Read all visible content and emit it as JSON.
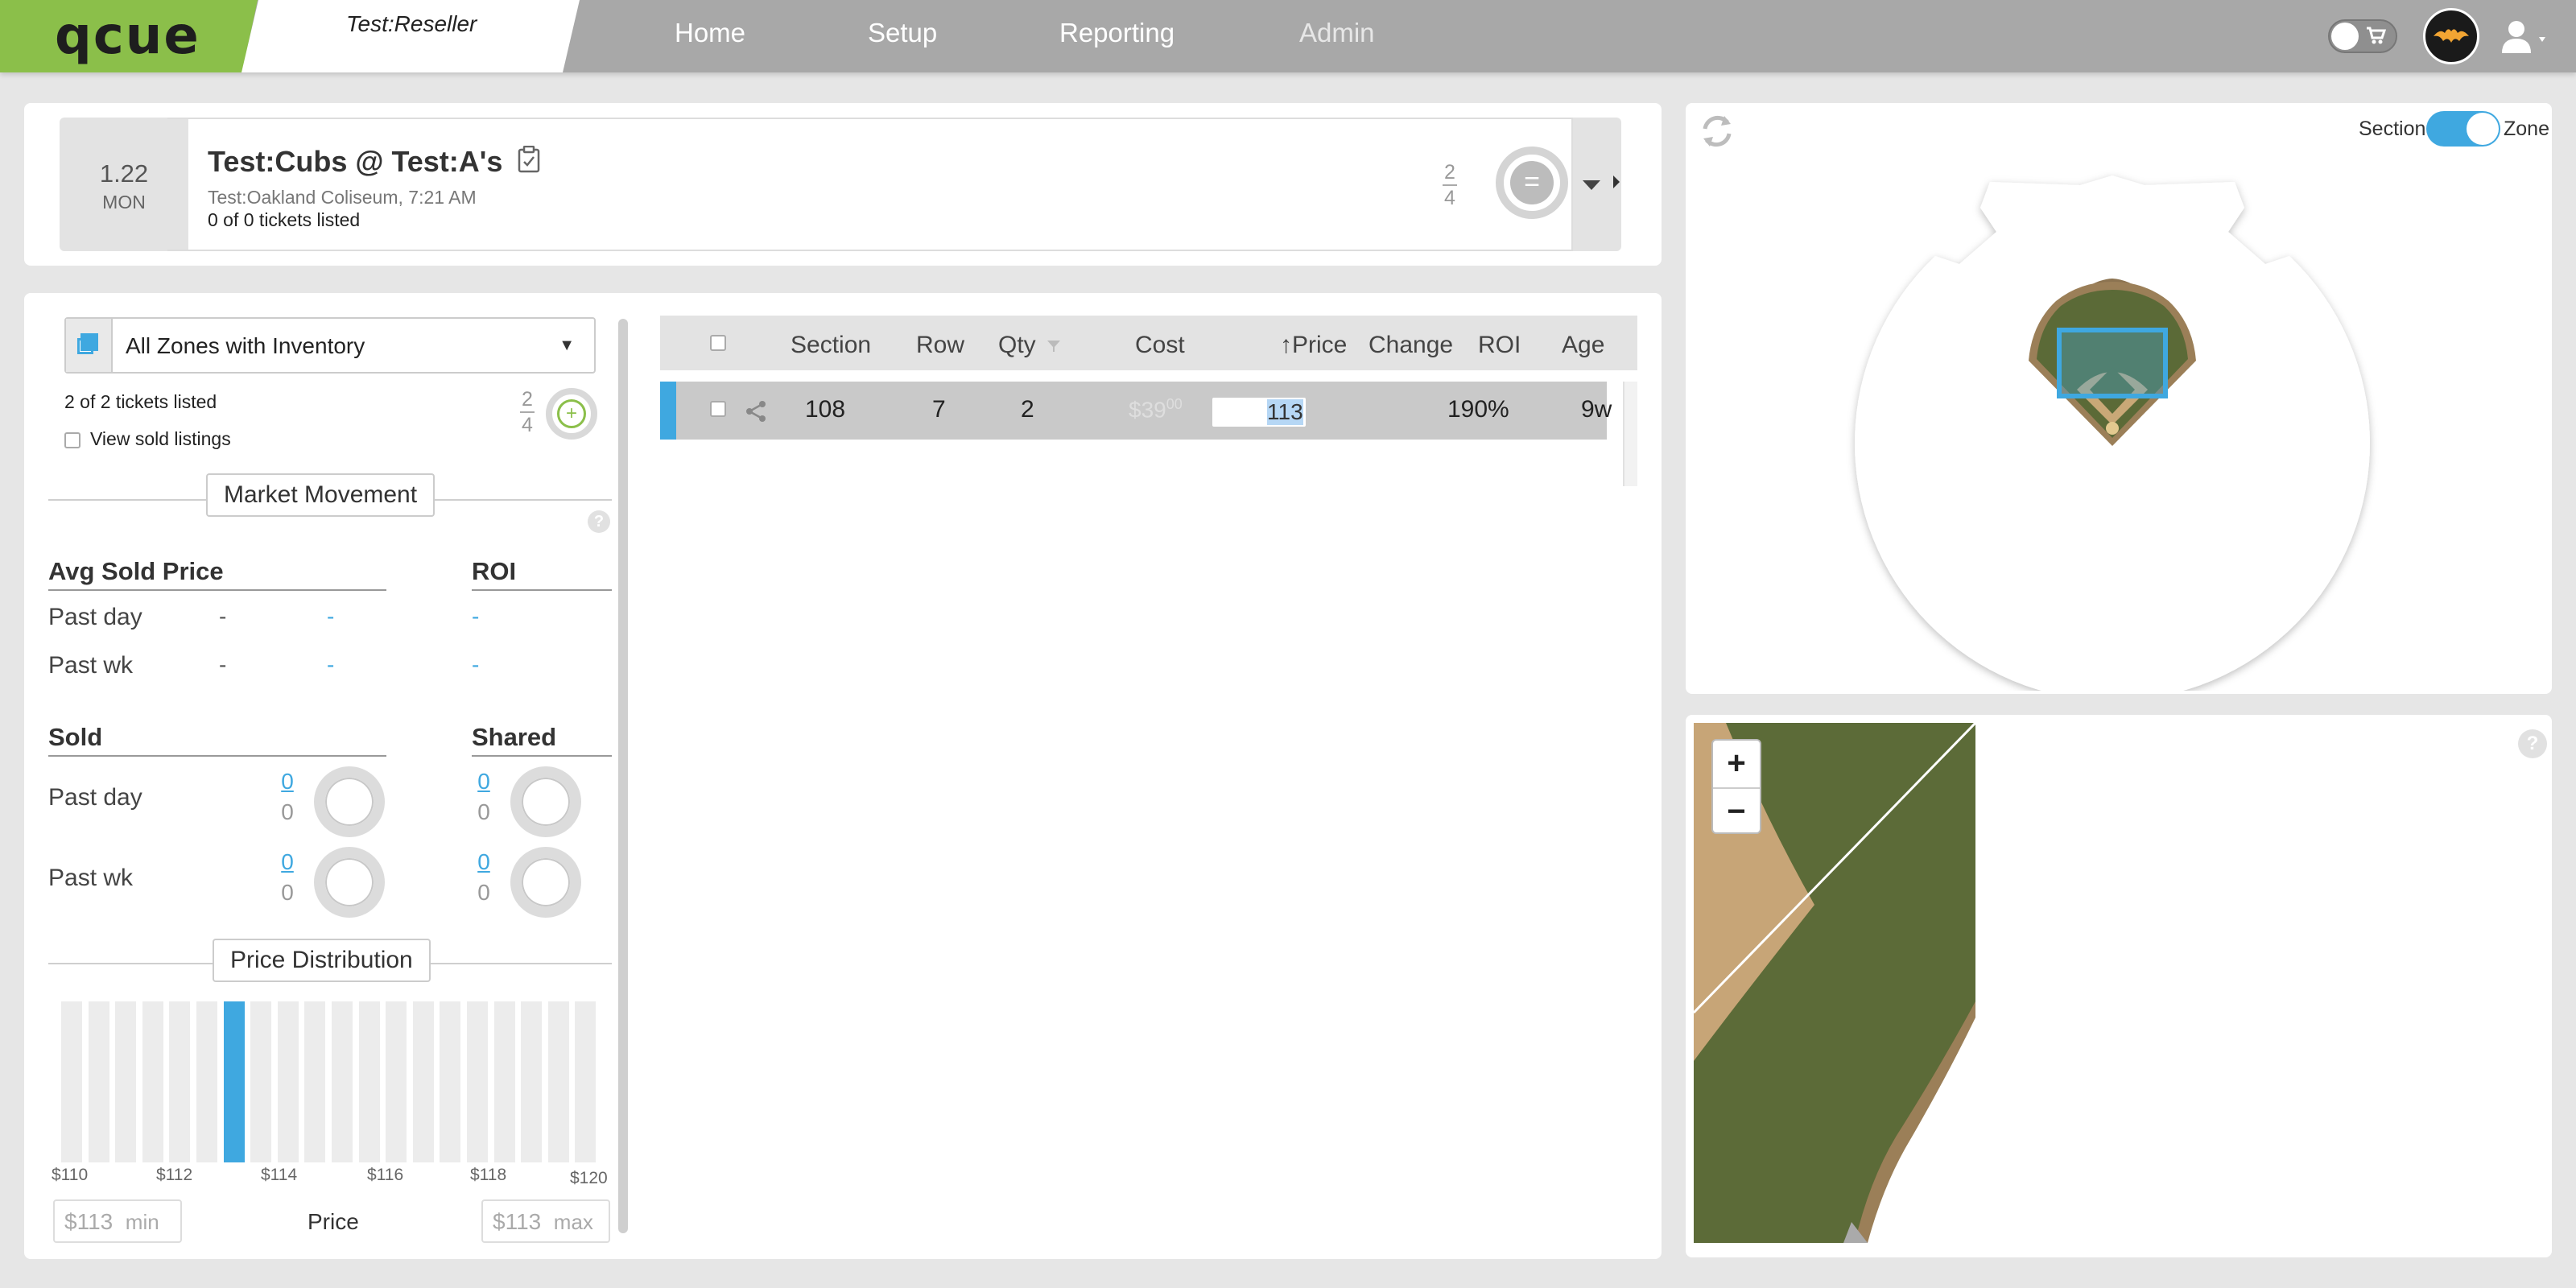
{
  "brand": {
    "logo_text": "qcue",
    "reseller": "Test:Reseller"
  },
  "nav": {
    "items": [
      "Home",
      "Setup",
      "Reporting",
      "Admin"
    ]
  },
  "header_icons": {
    "cart_toggle": "cart-toggle-icon",
    "avatar": "bat-logo-avatar",
    "user": "user-icon"
  },
  "event": {
    "date": "1.22",
    "day": "MON",
    "title": "Test:Cubs @ Test:A's",
    "venue": "Test:Oakland Coliseum, 7:21 AM",
    "tickets_listed": "0 of 0 tickets listed",
    "frac_top": "2",
    "frac_bottom": "4",
    "ring_symbol": "="
  },
  "inventory": {
    "zone_select": "All Zones with Inventory",
    "tickets_listed": "2 of 2 tickets listed",
    "view_sold": "View sold listings",
    "frac_top": "2",
    "frac_bottom": "4"
  },
  "market_movement": {
    "title": "Market Movement",
    "avg_sold_price": "Avg Sold Price",
    "roi": "ROI",
    "rows": [
      {
        "label": "Past day",
        "val1": "-",
        "val2": "-",
        "roi": "-"
      },
      {
        "label": "Past wk",
        "val1": "-",
        "val2": "-",
        "roi": "-"
      }
    ]
  },
  "sold_shared": {
    "sold": "Sold",
    "shared": "Shared",
    "rows": [
      {
        "label": "Past day",
        "sold_top": "0",
        "sold_bot": "0",
        "shared_top": "0",
        "shared_bot": "0"
      },
      {
        "label": "Past wk",
        "sold_top": "0",
        "sold_bot": "0",
        "shared_top": "0",
        "shared_bot": "0"
      }
    ]
  },
  "price_distribution": {
    "title": "Price Distribution",
    "ticks": [
      "$110",
      "$112",
      "$114",
      "$116",
      "$118",
      "$120"
    ],
    "bar_count": 20,
    "active_bar": 6,
    "min": "$113",
    "min_label": "min",
    "max": "$113",
    "max_label": "max",
    "axis_label": "Price"
  },
  "table": {
    "columns": [
      "Section",
      "Row",
      "Qty",
      "Cost",
      "Price",
      "Change",
      "ROI",
      "Age"
    ],
    "rows": [
      {
        "section": "108",
        "row": "7",
        "qty": "2",
        "cost": "$39",
        "cost_cents": "00",
        "price": "113",
        "change": "",
        "roi": "190%",
        "age": "9w"
      }
    ]
  },
  "seat_map": {
    "section_label": "Section",
    "zone_label": "Zone",
    "toggle": "zone"
  },
  "zoom_map": {
    "zoom_in": "+",
    "zoom_out": "−"
  },
  "colors": {
    "accent": "#3fa8e0",
    "brand_green": "#8bbf4a",
    "field_green": "#5c6b38",
    "dirt": "#c7a577"
  }
}
